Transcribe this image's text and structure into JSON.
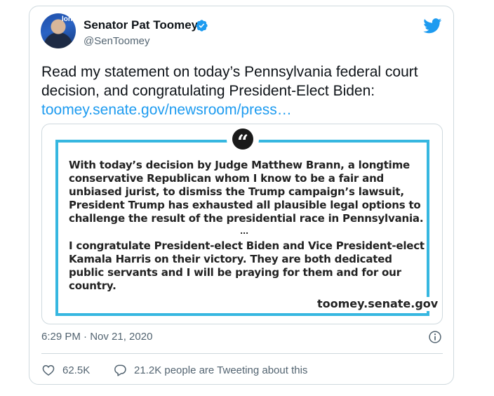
{
  "author": {
    "name": "Senator Pat Toomey",
    "handle": "@SenToomey",
    "avatar_logo_text": "lon"
  },
  "tweet": {
    "line1": "Read my statement on today’s Pennsylvania federal court",
    "line2": "decision, and congratulating President-Elect Biden:",
    "link": "toomey.senate.gov/newsroom/press…"
  },
  "media": {
    "quote_mark": "“",
    "paragraph1": [
      "With today’s decision by Judge Matthew Brann, a longtime",
      "conservative Republican whom I know to be a fair and",
      "unbiased jurist, to dismiss the Trump campaign’s lawsuit,",
      "President Trump has exhausted all plausible legal options to",
      "challenge the result of the presidential race in Pennsylvania."
    ],
    "ellipsis": "...",
    "paragraph2": [
      "I congratulate President-elect Biden and Vice President-elect",
      "Kamala Harris on their victory. They are both dedicated",
      "public servants and I will be praying for them and for our",
      "country."
    ],
    "site": "toomey.senate.gov"
  },
  "meta": {
    "timestamp": "6:29 PM · Nov 21, 2020"
  },
  "actions": {
    "likes": "62.5K",
    "conversation": "21.2K people are Tweeting about this"
  },
  "colors": {
    "twitter_blue": "#1d9bf0",
    "frame_blue": "#36b7e0",
    "secondary_text": "#536471",
    "border": "#cfd9de"
  },
  "icons": [
    "verified-badge-icon",
    "twitter-bird-icon",
    "info-icon",
    "heart-icon",
    "comment-bubble-icon",
    "quote-mark-icon"
  ]
}
